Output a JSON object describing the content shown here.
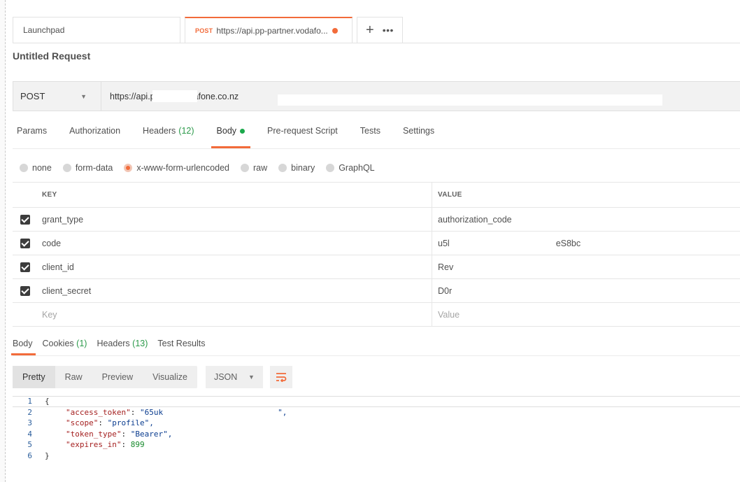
{
  "tabs": [
    {
      "label": "Launchpad"
    },
    {
      "method": "POST",
      "label": "https://api.pp-partner.vodafo...",
      "unsaved": true
    }
  ],
  "request": {
    "title": "Untitled Request",
    "method": "POST",
    "url": "https://api.p___er.vodafone.co.nz"
  },
  "request_tabs": [
    {
      "label": "Params"
    },
    {
      "label": "Authorization"
    },
    {
      "label": "Headers",
      "count": "(12)"
    },
    {
      "label": "Body",
      "active": true
    },
    {
      "label": "Pre-request Script"
    },
    {
      "label": "Tests"
    },
    {
      "label": "Settings"
    }
  ],
  "body_types": [
    "none",
    "form-data",
    "x-www-form-urlencoded",
    "raw",
    "binary",
    "GraphQL"
  ],
  "body_type_selected": "x-www-form-urlencoded",
  "params_table": {
    "headers": {
      "key": "KEY",
      "value": "VALUE"
    },
    "rows": [
      {
        "key": "grant_type",
        "value": "authorization_code",
        "checked": true
      },
      {
        "key": "code",
        "value": "u5l",
        "value_tail": "eS8bc",
        "checked": true
      },
      {
        "key": "client_id",
        "value": "Rev",
        "checked": true
      },
      {
        "key": "client_secret",
        "value": "D0r",
        "checked": true
      }
    ],
    "placeholder": {
      "key": "Key",
      "value": "Value"
    }
  },
  "response_tabs": [
    {
      "label": "Body",
      "active": true
    },
    {
      "label": "Cookies",
      "count": "(1)"
    },
    {
      "label": "Headers",
      "count": "(13)"
    },
    {
      "label": "Test Results"
    }
  ],
  "view_modes": [
    "Pretty",
    "Raw",
    "Preview",
    "Visualize"
  ],
  "view_mode_selected": "Pretty",
  "format": "JSON",
  "response_json": {
    "line_numbers": [
      "1",
      "2",
      "3",
      "4",
      "5",
      "6"
    ],
    "open": "{",
    "close": "}",
    "fields": [
      {
        "key": "\"access_token\"",
        "value": "\"65uk",
        "value_end": "\",",
        "type": "string"
      },
      {
        "key": "\"scope\"",
        "value": "\"profile\",",
        "type": "string"
      },
      {
        "key": "\"token_type\"",
        "value": "\"Bearer\",",
        "type": "string"
      },
      {
        "key": "\"expires_in\"",
        "value": "899",
        "type": "number"
      }
    ]
  },
  "colors": {
    "accent": "#f26b3a",
    "active_dot": "#1ba94c",
    "count": "#2b9a4a"
  }
}
